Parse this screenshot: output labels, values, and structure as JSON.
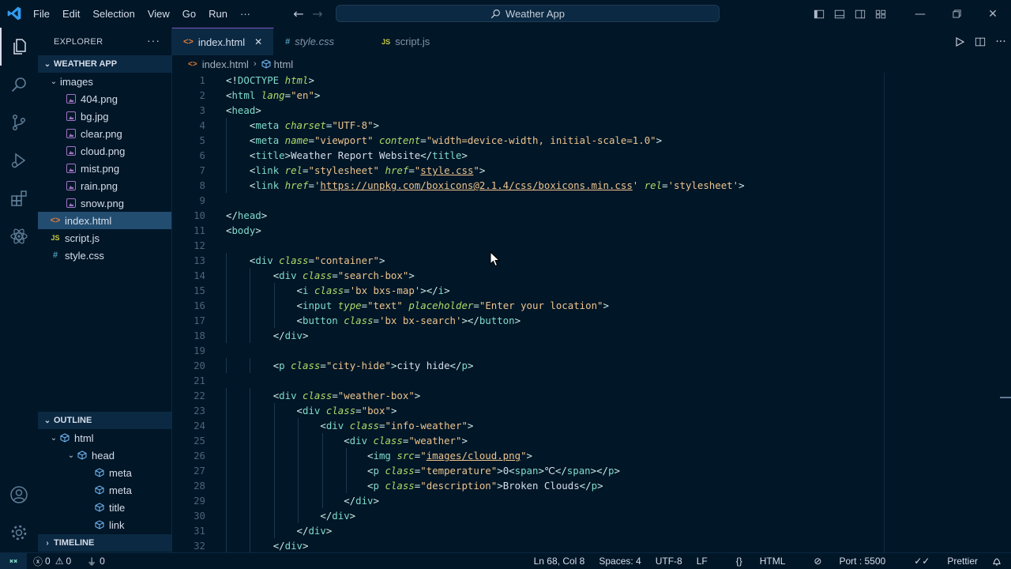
{
  "menu": [
    "File",
    "Edit",
    "Selection",
    "View",
    "Go",
    "Run",
    "···"
  ],
  "command_center": "Weather App",
  "explorer": {
    "title": "EXPLORER",
    "more": "···",
    "root": "WEATHER APP",
    "folder": "images",
    "images": [
      "404.png",
      "bg.jpg",
      "clear.png",
      "cloud.png",
      "mist.png",
      "rain.png",
      "snow.png"
    ],
    "files": [
      "index.html",
      "script.js",
      "style.css"
    ]
  },
  "outline": {
    "title": "OUTLINE",
    "items": [
      "html",
      "head",
      "meta",
      "meta",
      "title",
      "link"
    ]
  },
  "timeline": "TIMELINE",
  "tabs": [
    "index.html",
    "style.css",
    "script.js"
  ],
  "tab_icons": {
    "html": "<>",
    "css": "#",
    "js": "JS"
  },
  "breadcrumb": [
    "index.html",
    "html"
  ],
  "code_lines": [
    [
      [
        "t-tag",
        "<!"
      ],
      [
        "t-name",
        "DOCTYPE"
      ],
      [
        "t-txt",
        " "
      ],
      [
        "t-attr",
        "html"
      ],
      [
        "t-tag",
        ">"
      ]
    ],
    [
      [
        "t-tag",
        "<"
      ],
      [
        "t-name",
        "html"
      ],
      [
        "t-txt",
        " "
      ],
      [
        "t-attr",
        "lang"
      ],
      [
        "t-tag",
        "="
      ],
      [
        "t-str",
        "\"en\""
      ],
      [
        "t-tag",
        ">"
      ]
    ],
    [
      [
        "t-tag",
        "<"
      ],
      [
        "t-name",
        "head"
      ],
      [
        "t-tag",
        ">"
      ]
    ],
    [
      [
        "t-txt",
        "    "
      ],
      [
        "t-tag",
        "<"
      ],
      [
        "t-name",
        "meta"
      ],
      [
        "t-txt",
        " "
      ],
      [
        "t-attr",
        "charset"
      ],
      [
        "t-tag",
        "="
      ],
      [
        "t-str",
        "\"UTF-8\""
      ],
      [
        "t-tag",
        ">"
      ]
    ],
    [
      [
        "t-txt",
        "    "
      ],
      [
        "t-tag",
        "<"
      ],
      [
        "t-name",
        "meta"
      ],
      [
        "t-txt",
        " "
      ],
      [
        "t-attr",
        "name"
      ],
      [
        "t-tag",
        "="
      ],
      [
        "t-str",
        "\"viewport\""
      ],
      [
        "t-txt",
        " "
      ],
      [
        "t-attr",
        "content"
      ],
      [
        "t-tag",
        "="
      ],
      [
        "t-str",
        "\"width=device-width, initial-scale=1.0\""
      ],
      [
        "t-tag",
        ">"
      ]
    ],
    [
      [
        "t-txt",
        "    "
      ],
      [
        "t-tag",
        "<"
      ],
      [
        "t-name",
        "title"
      ],
      [
        "t-tag",
        ">"
      ],
      [
        "t-txt",
        "Weather Report Website"
      ],
      [
        "t-tag",
        "</"
      ],
      [
        "t-name",
        "title"
      ],
      [
        "t-tag",
        ">"
      ]
    ],
    [
      [
        "t-txt",
        "    "
      ],
      [
        "t-tag",
        "<"
      ],
      [
        "t-name",
        "link"
      ],
      [
        "t-txt",
        " "
      ],
      [
        "t-attr",
        "rel"
      ],
      [
        "t-tag",
        "="
      ],
      [
        "t-str",
        "\"stylesheet\""
      ],
      [
        "t-txt",
        " "
      ],
      [
        "t-attr",
        "href"
      ],
      [
        "t-tag",
        "="
      ],
      [
        "t-str",
        "\""
      ],
      [
        "t-str t-link",
        "style.css"
      ],
      [
        "t-str",
        "\""
      ],
      [
        "t-tag",
        ">"
      ]
    ],
    [
      [
        "t-txt",
        "    "
      ],
      [
        "t-tag",
        "<"
      ],
      [
        "t-name",
        "link"
      ],
      [
        "t-txt",
        " "
      ],
      [
        "t-attr",
        "href"
      ],
      [
        "t-tag",
        "="
      ],
      [
        "t-str",
        "'"
      ],
      [
        "t-str t-link",
        "https://unpkg.com/boxicons@2.1.4/css/boxicons.min.css"
      ],
      [
        "t-str",
        "'"
      ],
      [
        "t-txt",
        " "
      ],
      [
        "t-attr",
        "rel"
      ],
      [
        "t-tag",
        "="
      ],
      [
        "t-str",
        "'stylesheet'"
      ],
      [
        "t-tag",
        ">"
      ]
    ],
    [],
    [
      [
        "t-tag",
        "</"
      ],
      [
        "t-name",
        "head"
      ],
      [
        "t-tag",
        ">"
      ]
    ],
    [
      [
        "t-tag",
        "<"
      ],
      [
        "t-name",
        "body"
      ],
      [
        "t-tag",
        ">"
      ]
    ],
    [],
    [
      [
        "t-txt",
        "    "
      ],
      [
        "t-tag",
        "<"
      ],
      [
        "t-name",
        "div"
      ],
      [
        "t-txt",
        " "
      ],
      [
        "t-attr",
        "class"
      ],
      [
        "t-tag",
        "="
      ],
      [
        "t-str",
        "\"container\""
      ],
      [
        "t-tag",
        ">"
      ]
    ],
    [
      [
        "t-txt",
        "        "
      ],
      [
        "t-tag",
        "<"
      ],
      [
        "t-name",
        "div"
      ],
      [
        "t-txt",
        " "
      ],
      [
        "t-attr",
        "class"
      ],
      [
        "t-tag",
        "="
      ],
      [
        "t-str",
        "\"search-box\""
      ],
      [
        "t-tag",
        ">"
      ]
    ],
    [
      [
        "t-txt",
        "            "
      ],
      [
        "t-tag",
        "<"
      ],
      [
        "t-name",
        "i"
      ],
      [
        "t-txt",
        " "
      ],
      [
        "t-attr",
        "class"
      ],
      [
        "t-tag",
        "="
      ],
      [
        "t-str",
        "'bx bxs-map'"
      ],
      [
        "t-tag",
        "></"
      ],
      [
        "t-name",
        "i"
      ],
      [
        "t-tag",
        ">"
      ]
    ],
    [
      [
        "t-txt",
        "            "
      ],
      [
        "t-tag",
        "<"
      ],
      [
        "t-name",
        "input"
      ],
      [
        "t-txt",
        " "
      ],
      [
        "t-attr",
        "type"
      ],
      [
        "t-tag",
        "="
      ],
      [
        "t-str",
        "\"text\""
      ],
      [
        "t-txt",
        " "
      ],
      [
        "t-attr",
        "placeholder"
      ],
      [
        "t-tag",
        "="
      ],
      [
        "t-str",
        "\"Enter your location\""
      ],
      [
        "t-tag",
        ">"
      ]
    ],
    [
      [
        "t-txt",
        "            "
      ],
      [
        "t-tag",
        "<"
      ],
      [
        "t-name",
        "button"
      ],
      [
        "t-txt",
        " "
      ],
      [
        "t-attr",
        "class"
      ],
      [
        "t-tag",
        "="
      ],
      [
        "t-str",
        "'bx bx-search'"
      ],
      [
        "t-tag",
        "></"
      ],
      [
        "t-name",
        "button"
      ],
      [
        "t-tag",
        ">"
      ]
    ],
    [
      [
        "t-txt",
        "        "
      ],
      [
        "t-tag",
        "</"
      ],
      [
        "t-name",
        "div"
      ],
      [
        "t-tag",
        ">"
      ]
    ],
    [],
    [
      [
        "t-txt",
        "        "
      ],
      [
        "t-tag",
        "<"
      ],
      [
        "t-name",
        "p"
      ],
      [
        "t-txt",
        " "
      ],
      [
        "t-attr",
        "class"
      ],
      [
        "t-tag",
        "="
      ],
      [
        "t-str",
        "\"city-hide\""
      ],
      [
        "t-tag",
        ">"
      ],
      [
        "t-txt",
        "city hide"
      ],
      [
        "t-tag",
        "</"
      ],
      [
        "t-name",
        "p"
      ],
      [
        "t-tag",
        ">"
      ]
    ],
    [],
    [
      [
        "t-txt",
        "        "
      ],
      [
        "t-tag",
        "<"
      ],
      [
        "t-name",
        "div"
      ],
      [
        "t-txt",
        " "
      ],
      [
        "t-attr",
        "class"
      ],
      [
        "t-tag",
        "="
      ],
      [
        "t-str",
        "\"weather-box\""
      ],
      [
        "t-tag",
        ">"
      ]
    ],
    [
      [
        "t-txt",
        "            "
      ],
      [
        "t-tag",
        "<"
      ],
      [
        "t-name",
        "div"
      ],
      [
        "t-txt",
        " "
      ],
      [
        "t-attr",
        "class"
      ],
      [
        "t-tag",
        "="
      ],
      [
        "t-str",
        "\"box\""
      ],
      [
        "t-tag",
        ">"
      ]
    ],
    [
      [
        "t-txt",
        "                "
      ],
      [
        "t-tag",
        "<"
      ],
      [
        "t-name",
        "div"
      ],
      [
        "t-txt",
        " "
      ],
      [
        "t-attr",
        "class"
      ],
      [
        "t-tag",
        "="
      ],
      [
        "t-str",
        "\"info-weather\""
      ],
      [
        "t-tag",
        ">"
      ]
    ],
    [
      [
        "t-txt",
        "                    "
      ],
      [
        "t-tag",
        "<"
      ],
      [
        "t-name",
        "div"
      ],
      [
        "t-txt",
        " "
      ],
      [
        "t-attr",
        "class"
      ],
      [
        "t-tag",
        "="
      ],
      [
        "t-str",
        "\"weather\""
      ],
      [
        "t-tag",
        ">"
      ]
    ],
    [
      [
        "t-txt",
        "                        "
      ],
      [
        "t-tag",
        "<"
      ],
      [
        "t-name",
        "img"
      ],
      [
        "t-txt",
        " "
      ],
      [
        "t-attr",
        "src"
      ],
      [
        "t-tag",
        "="
      ],
      [
        "t-str",
        "\""
      ],
      [
        "t-str t-link",
        "images/cloud.png"
      ],
      [
        "t-str",
        "\""
      ],
      [
        "t-tag",
        ">"
      ]
    ],
    [
      [
        "t-txt",
        "                        "
      ],
      [
        "t-tag",
        "<"
      ],
      [
        "t-name",
        "p"
      ],
      [
        "t-txt",
        " "
      ],
      [
        "t-attr",
        "class"
      ],
      [
        "t-tag",
        "="
      ],
      [
        "t-str",
        "\"temperature\""
      ],
      [
        "t-tag",
        ">"
      ],
      [
        "t-txt",
        "0"
      ],
      [
        "t-tag",
        "<"
      ],
      [
        "t-name",
        "span"
      ],
      [
        "t-tag",
        ">"
      ],
      [
        "t-txt",
        "℃"
      ],
      [
        "t-tag",
        "</"
      ],
      [
        "t-name",
        "span"
      ],
      [
        "t-tag",
        "></"
      ],
      [
        "t-name",
        "p"
      ],
      [
        "t-tag",
        ">"
      ]
    ],
    [
      [
        "t-txt",
        "                        "
      ],
      [
        "t-tag",
        "<"
      ],
      [
        "t-name",
        "p"
      ],
      [
        "t-txt",
        " "
      ],
      [
        "t-attr",
        "class"
      ],
      [
        "t-tag",
        "="
      ],
      [
        "t-str",
        "\"description\""
      ],
      [
        "t-tag",
        ">"
      ],
      [
        "t-txt",
        "Broken Clouds"
      ],
      [
        "t-tag",
        "</"
      ],
      [
        "t-name",
        "p"
      ],
      [
        "t-tag",
        ">"
      ]
    ],
    [
      [
        "t-txt",
        "                    "
      ],
      [
        "t-tag",
        "</"
      ],
      [
        "t-name",
        "div"
      ],
      [
        "t-tag",
        ">"
      ]
    ],
    [
      [
        "t-txt",
        "                "
      ],
      [
        "t-tag",
        "</"
      ],
      [
        "t-name",
        "div"
      ],
      [
        "t-tag",
        ">"
      ]
    ],
    [
      [
        "t-txt",
        "            "
      ],
      [
        "t-tag",
        "</"
      ],
      [
        "t-name",
        "div"
      ],
      [
        "t-tag",
        ">"
      ]
    ],
    [
      [
        "t-txt",
        "        "
      ],
      [
        "t-tag",
        "</"
      ],
      [
        "t-name",
        "div"
      ],
      [
        "t-tag",
        ">"
      ]
    ]
  ],
  "status": {
    "errors": "0",
    "warnings": "0",
    "ports": "0",
    "position": "Ln 68, Col 8",
    "spaces": "Spaces: 4",
    "encoding": "UTF-8",
    "eol": "LF",
    "language": "HTML",
    "port": "Port : 5500",
    "prettier": "Prettier"
  },
  "colors": {
    "background": "#011627",
    "accent": "#7e57c2",
    "selection": "#234d70"
  }
}
